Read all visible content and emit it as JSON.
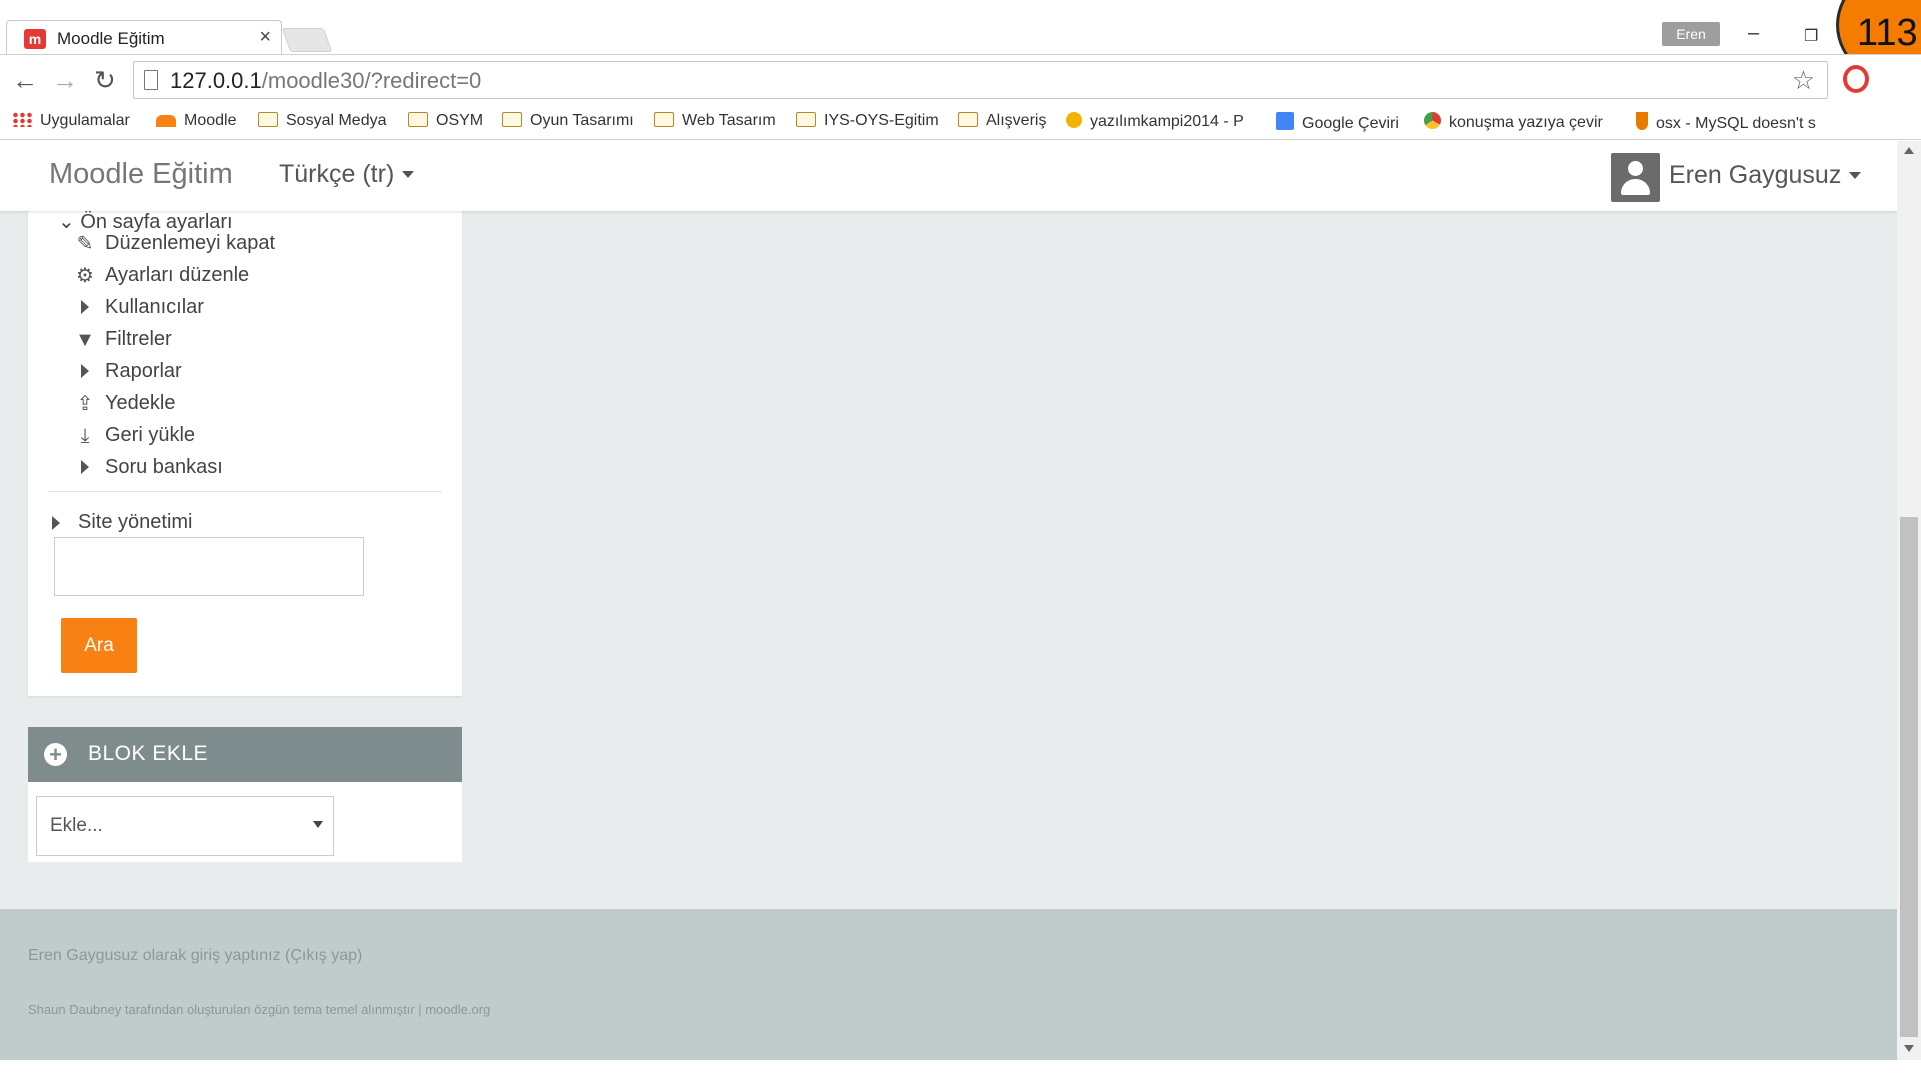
{
  "browser": {
    "tab_title": "Moodle Eğitim",
    "tab_favicon": "m",
    "profile_name": "Eren",
    "counter": "113",
    "url_host": "127.0.0.1",
    "url_path": "/moodle30/?redirect=0"
  },
  "bookmarks": [
    {
      "label": "Uygulamalar",
      "icon": "apps-grid-icon"
    },
    {
      "label": "Moodle",
      "icon": "moodle-icon"
    },
    {
      "label": "Sosyal Medya",
      "icon": "folder-icon"
    },
    {
      "label": "OSYM",
      "icon": "folder-icon"
    },
    {
      "label": "Oyun Tasarımı",
      "icon": "folder-icon"
    },
    {
      "label": "Web Tasarım",
      "icon": "folder-icon"
    },
    {
      "label": "IYS-OYS-Egitim",
      "icon": "folder-icon"
    },
    {
      "label": "Alışveriş",
      "icon": "folder-icon"
    },
    {
      "label": "yazılımkampi2014 - P",
      "icon": "cat-icon"
    },
    {
      "label": "Google Çeviri",
      "icon": "google-translate-icon"
    },
    {
      "label": "konuşma yazıya çevir",
      "icon": "chrome-icon"
    },
    {
      "label": "osx - MySQL doesn't s",
      "icon": "java-icon"
    }
  ],
  "navbar": {
    "brand": "Moodle Eğitim",
    "language": "Türkçe (tr)",
    "user_name": "Eren Gaygusuz"
  },
  "admin_block": {
    "cut_item": "Ön sayfa ayarları",
    "items": [
      {
        "label": "Düzenlemeyi kapat",
        "icon": "pencil-icon"
      },
      {
        "label": "Ayarları düzenle",
        "icon": "gear-icon"
      },
      {
        "label": "Kullanıcılar",
        "icon": "expand-arrow-icon"
      },
      {
        "label": "Filtreler",
        "icon": "filter-icon"
      },
      {
        "label": "Raporlar",
        "icon": "expand-arrow-icon"
      },
      {
        "label": "Yedekle",
        "icon": "upload-icon"
      },
      {
        "label": "Geri yükle",
        "icon": "download-icon"
      },
      {
        "label": "Soru bankası",
        "icon": "expand-arrow-icon"
      }
    ],
    "site_admin": "Site yönetimi",
    "search_button": "Ara"
  },
  "add_block": {
    "title": "BLOK EKLE",
    "select_value": "Ekle..."
  },
  "footer": {
    "login_info": "Eren Gaygusuz olarak giriş yaptınız (Çıkış yap)",
    "credit": "Shaun Daubney tarafından oluşturulan özgün tema temel alınmıştır | moodle.org"
  },
  "colors": {
    "accent": "#f98012",
    "block_header": "#7f8c8d",
    "footer_bg": "#c0cccc"
  }
}
